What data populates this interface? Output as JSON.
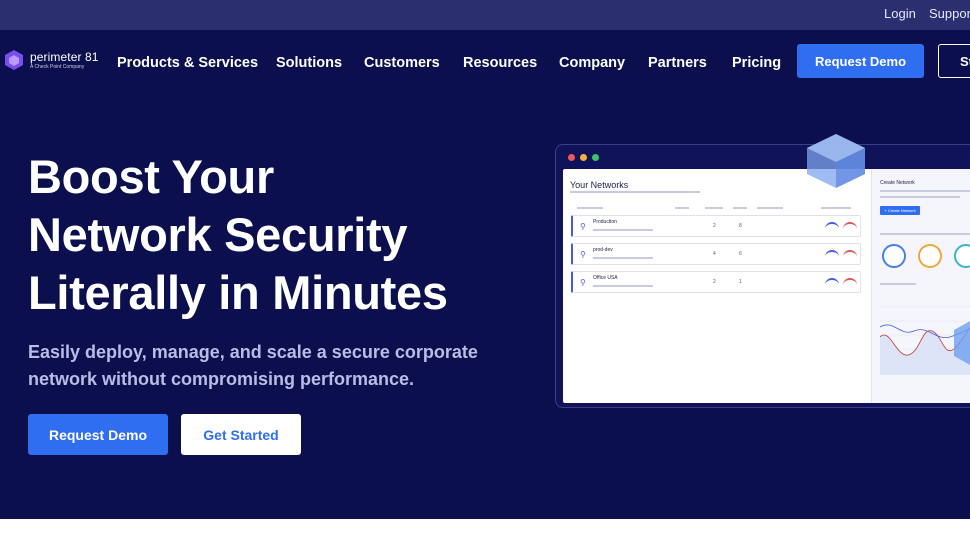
{
  "topbar": {
    "login": "Login",
    "support": "Support"
  },
  "logo": {
    "name": "perimeter 81",
    "tagline": "A Check Point Company"
  },
  "nav": {
    "items": [
      "Products & Services",
      "Solutions",
      "Customers",
      "Resources",
      "Company",
      "Partners",
      "Pricing"
    ],
    "request_demo": "Request Demo",
    "get_started": "St"
  },
  "hero": {
    "headline": [
      "Boost Your",
      "Network Security",
      "Literally in Minutes"
    ],
    "subhead": "Easily deploy, manage, and scale a secure corporate network without compromising performance.",
    "request_demo": "Request Demo",
    "get_started": "Get Started"
  },
  "mockup": {
    "title": "Your Networks",
    "rows": [
      {
        "name": "Production",
        "col2": "2",
        "col3": "8"
      },
      {
        "name": "prod-dev",
        "col2": "4",
        "col3": "6"
      },
      {
        "name": "Office USA",
        "col2": "2",
        "col3": "1"
      }
    ],
    "side_title": "Create Network",
    "side_button": "+ Create Network"
  },
  "colors": {
    "background": "#0c0f4d",
    "accent": "#2f6ef0",
    "topbar": "#2a2f6f"
  }
}
